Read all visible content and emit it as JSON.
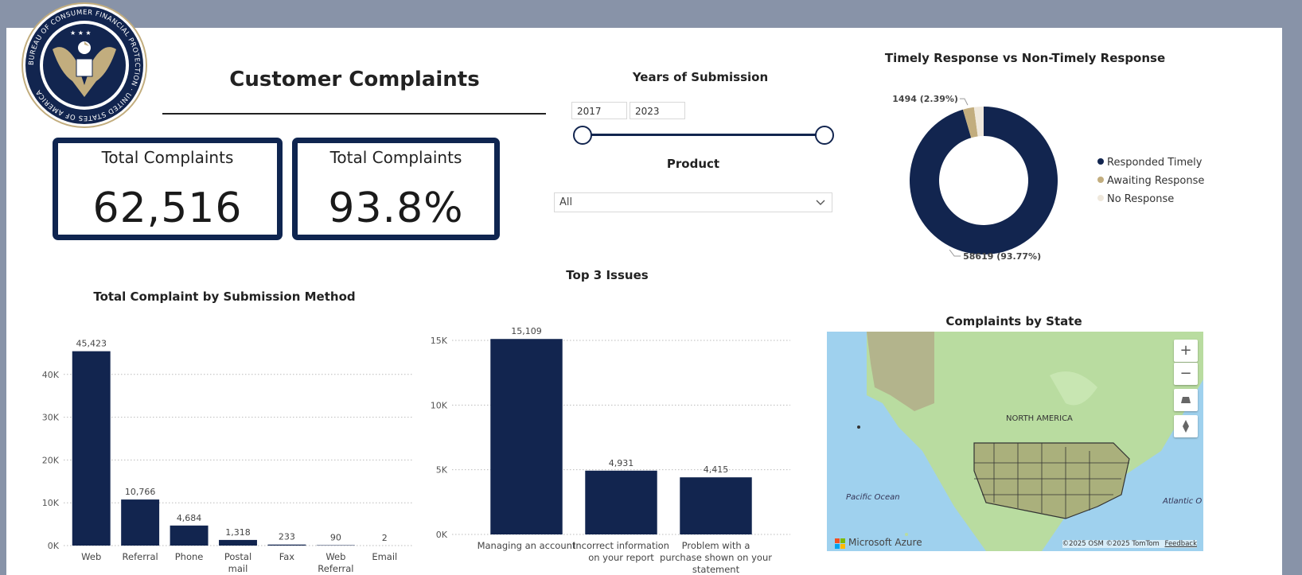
{
  "header": {
    "title": "Customer Complaints",
    "logo_text": "BUREAU OF CONSUMER FINANCIAL PROTECTION · UNITED STATES OF AMERICA"
  },
  "cards": [
    {
      "label": "Total Complaints",
      "value": "62,516"
    },
    {
      "label": "Total Complaints",
      "value": "93.8%"
    }
  ],
  "filters": {
    "years_title": "Years of Submission",
    "year_start": "2017",
    "year_end": "2023",
    "product_title": "Product",
    "product_value": "All"
  },
  "map": {
    "title": "Complaints by State",
    "labels": {
      "continent": "NORTH AMERICA",
      "pacific": "Pacific Ocean",
      "atlantic": "Atlantic O"
    },
    "attribution": "©2025 OSM  ©2025 TomTom",
    "feedback": "Feedback",
    "brand": "Microsoft Azure",
    "buttons": {
      "zoom_in": "+",
      "zoom_out": "−"
    }
  },
  "chart_data": [
    {
      "type": "pie",
      "title": "Timely Response vs Non-Timely Response",
      "categories": [
        "Responded Timely",
        "Awaiting Response",
        "No Response"
      ],
      "values": [
        58619,
        1494,
        1286
      ],
      "colors": [
        "#12254f",
        "#c2ad7e",
        "#efe8dc"
      ],
      "data_labels": [
        "58619 (93.77%)",
        "1494 (2.39%)"
      ],
      "legend": "right"
    },
    {
      "type": "bar",
      "title": "Total Complaint by Submission Method",
      "categories": [
        "Web",
        "Referral",
        "Phone",
        "Postal mail",
        "Fax",
        "Web Referral",
        "Email"
      ],
      "values": [
        45423,
        10766,
        4684,
        1318,
        233,
        90,
        2
      ],
      "data_labels": [
        "45,423",
        "10,766",
        "4,684",
        "1,318",
        "233",
        "90",
        "2"
      ],
      "ylim": [
        0,
        50000
      ],
      "yticks": [
        "0K",
        "10K",
        "20K",
        "30K",
        "40K"
      ],
      "ytick_values": [
        0,
        10000,
        20000,
        30000,
        40000
      ],
      "grid": true,
      "color": "#12254f"
    },
    {
      "type": "bar",
      "title": "Top 3 Issues",
      "categories": [
        "Managing an account",
        "Incorrect information on your report",
        "Problem with a purchase shown on your statement"
      ],
      "values": [
        15109,
        4931,
        4415
      ],
      "data_labels": [
        "15,109",
        "4,931",
        "4,415"
      ],
      "ylim": [
        0,
        15000
      ],
      "yticks": [
        "0K",
        "5K",
        "10K",
        "15K"
      ],
      "ytick_values": [
        0,
        5000,
        10000,
        15000
      ],
      "grid": true,
      "color": "#12254f"
    }
  ]
}
